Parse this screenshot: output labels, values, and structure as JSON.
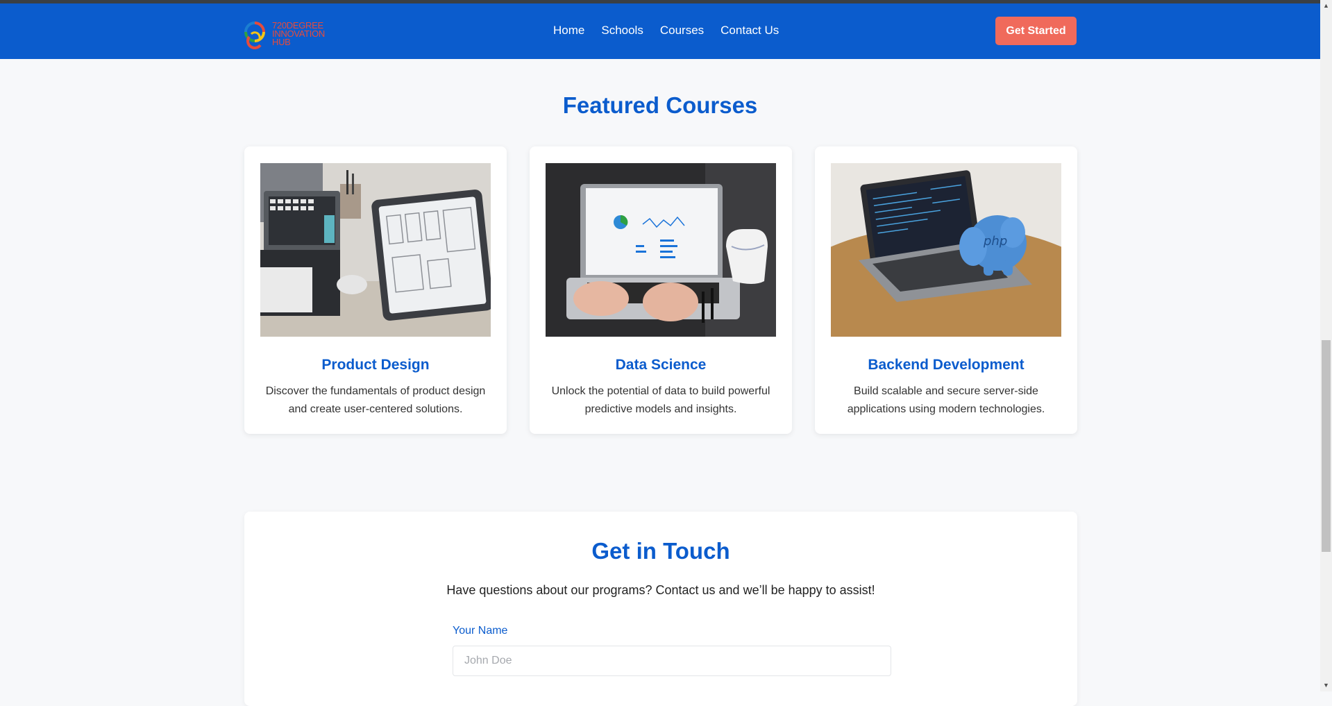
{
  "logo": {
    "line1": "720DEGREE",
    "line2": "INNOVATION",
    "line3": "HUB"
  },
  "nav": {
    "links": [
      "Home",
      "Schools",
      "Courses",
      "Contact Us"
    ],
    "cta": "Get Started"
  },
  "featured": {
    "title": "Featured Courses",
    "courses": [
      {
        "title": "Product Design",
        "description": "Discover the fundamentals of product design and create user-centered solutions."
      },
      {
        "title": "Data Science",
        "description": "Unlock the potential of data to build powerful predictive models and insights."
      },
      {
        "title": "Backend Development",
        "description": "Build scalable and secure server-side applications using modern technologies."
      }
    ]
  },
  "contact": {
    "title": "Get in Touch",
    "subtitle": "Have questions about our programs? Contact us and we’ll be happy to assist!",
    "name_label": "Your Name",
    "name_placeholder": "John Doe",
    "name_value": ""
  },
  "icons": {
    "scroll_up": "scroll-up-arrow-icon",
    "scroll_down": "scroll-down-arrow-icon"
  },
  "colors": {
    "primary": "#0b5ccd",
    "cta": "#f06a5b",
    "background": "#f7f8fa"
  }
}
